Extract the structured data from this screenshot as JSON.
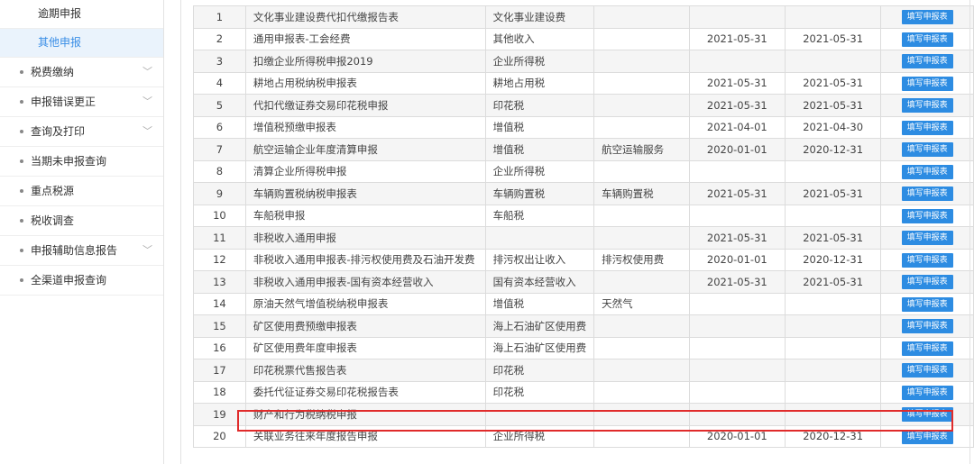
{
  "sidebar": {
    "sub_items": [
      {
        "label": "逾期申报",
        "active": false
      },
      {
        "label": "其他申报",
        "active": true
      }
    ],
    "items": [
      {
        "label": "税费缴纳",
        "has_children": true
      },
      {
        "label": "申报错误更正",
        "has_children": true
      },
      {
        "label": "查询及打印",
        "has_children": true
      },
      {
        "label": "当期未申报查询",
        "has_children": false
      },
      {
        "label": "重点税源",
        "has_children": false
      },
      {
        "label": "税收调查",
        "has_children": false
      },
      {
        "label": "申报辅助信息报告",
        "has_children": true
      },
      {
        "label": "全渠道申报查询",
        "has_children": false
      }
    ]
  },
  "table": {
    "button_label": "填写申报表",
    "rows": [
      {
        "no": "1",
        "name": "文化事业建设费代扣代缴报告表",
        "tax": "文化事业建设费",
        "item": "",
        "start": "",
        "end": ""
      },
      {
        "no": "2",
        "name": "通用申报表-工会经费",
        "tax": "其他收入",
        "item": "",
        "start": "2021-05-31",
        "end": "2021-05-31"
      },
      {
        "no": "3",
        "name": "扣缴企业所得税申报2019",
        "tax": "企业所得税",
        "item": "",
        "start": "",
        "end": ""
      },
      {
        "no": "4",
        "name": "耕地占用税纳税申报表",
        "tax": "耕地占用税",
        "item": "",
        "start": "2021-05-31",
        "end": "2021-05-31"
      },
      {
        "no": "5",
        "name": "代扣代缴证券交易印花税申报",
        "tax": "印花税",
        "item": "",
        "start": "2021-05-31",
        "end": "2021-05-31"
      },
      {
        "no": "6",
        "name": "增值税预缴申报表",
        "tax": "增值税",
        "item": "",
        "start": "2021-04-01",
        "end": "2021-04-30"
      },
      {
        "no": "7",
        "name": "航空运输企业年度清算申报",
        "tax": "增值税",
        "item": "航空运输服务",
        "start": "2020-01-01",
        "end": "2020-12-31"
      },
      {
        "no": "8",
        "name": "清算企业所得税申报",
        "tax": "企业所得税",
        "item": "",
        "start": "",
        "end": ""
      },
      {
        "no": "9",
        "name": "车辆购置税纳税申报表",
        "tax": "车辆购置税",
        "item": "车辆购置税",
        "start": "2021-05-31",
        "end": "2021-05-31"
      },
      {
        "no": "10",
        "name": "车船税申报",
        "tax": "车船税",
        "item": "",
        "start": "",
        "end": ""
      },
      {
        "no": "11",
        "name": "非税收入通用申报",
        "tax": "",
        "item": "",
        "start": "2021-05-31",
        "end": "2021-05-31"
      },
      {
        "no": "12",
        "name": "非税收入通用申报表-排污权使用费及石油开发费",
        "tax": "排污权出让收入",
        "item": "排污权使用费",
        "start": "2020-01-01",
        "end": "2020-12-31"
      },
      {
        "no": "13",
        "name": "非税收入通用申报表-国有资本经营收入",
        "tax": "国有资本经营收入",
        "item": "",
        "start": "2021-05-31",
        "end": "2021-05-31"
      },
      {
        "no": "14",
        "name": "原油天然气增值税纳税申报表",
        "tax": "增值税",
        "item": "天然气",
        "start": "",
        "end": ""
      },
      {
        "no": "15",
        "name": "矿区使用费预缴申报表",
        "tax": "海上石油矿区使用费",
        "item": "",
        "start": "",
        "end": ""
      },
      {
        "no": "16",
        "name": "矿区使用费年度申报表",
        "tax": "海上石油矿区使用费",
        "item": "",
        "start": "",
        "end": ""
      },
      {
        "no": "17",
        "name": "印花税票代售报告表",
        "tax": "印花税",
        "item": "",
        "start": "",
        "end": ""
      },
      {
        "no": "18",
        "name": "委托代征证券交易印花税报告表",
        "tax": "印花税",
        "item": "",
        "start": "",
        "end": ""
      },
      {
        "no": "19",
        "name": "财产和行为税纳税申报",
        "tax": "",
        "item": "",
        "start": "",
        "end": ""
      },
      {
        "no": "20",
        "name": "关联业务往来年度报告申报",
        "tax": "企业所得税",
        "item": "",
        "start": "2020-01-01",
        "end": "2020-12-31"
      }
    ]
  },
  "highlight_color": "#e02b2b",
  "accent_color": "#2d8ce2"
}
